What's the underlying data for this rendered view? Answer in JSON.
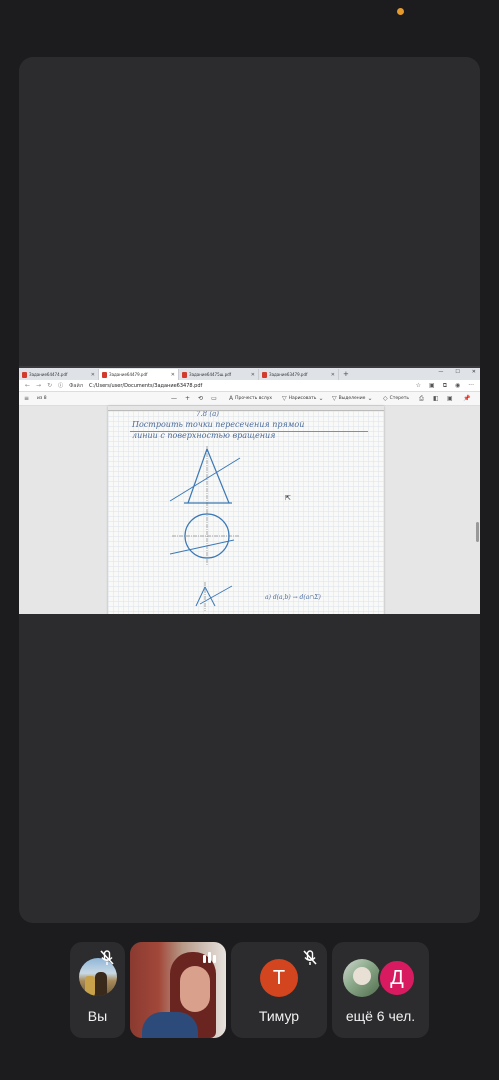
{
  "screen_share": {
    "tabs": [
      {
        "label": "Задание64474.pdf",
        "active": false
      },
      {
        "label": "Задание64479.pdf",
        "active": true
      },
      {
        "label": "Задание64475ш.pdf",
        "active": false
      },
      {
        "label": "Задание63479.pdf",
        "active": false
      }
    ],
    "address": {
      "file_label": "Файл",
      "url": "C:/Users/user/Documents/Задание63478.pdf"
    },
    "pdf_toolbar": {
      "page_indicator": "из 8",
      "read_aloud": "Прочесть вслух",
      "draw": "Нарисовать",
      "highlight": "Выделение",
      "erase": "Стереть"
    },
    "document": {
      "heading": "7.8 (а)",
      "line1": "Построить   точки   пересечения   прямой",
      "line2": "линии   с   поверхностью   вращения",
      "note": "а) d(a,b) → d(a∩Σ)"
    }
  },
  "participants": [
    {
      "label": "Вы",
      "mic_muted": true
    },
    {
      "label": "",
      "speaking": true
    },
    {
      "label": "Тимур",
      "initial": "Т",
      "avatar_color": "#d2451e",
      "mic_muted": true
    },
    {
      "label": "ещё 6 чел.",
      "initial": "Д",
      "avatar_color": "#d81b60"
    }
  ],
  "colors": {
    "background": "#1c1c1e",
    "tile": "#2c2c2e",
    "recording_dot": "#e69a2c"
  }
}
